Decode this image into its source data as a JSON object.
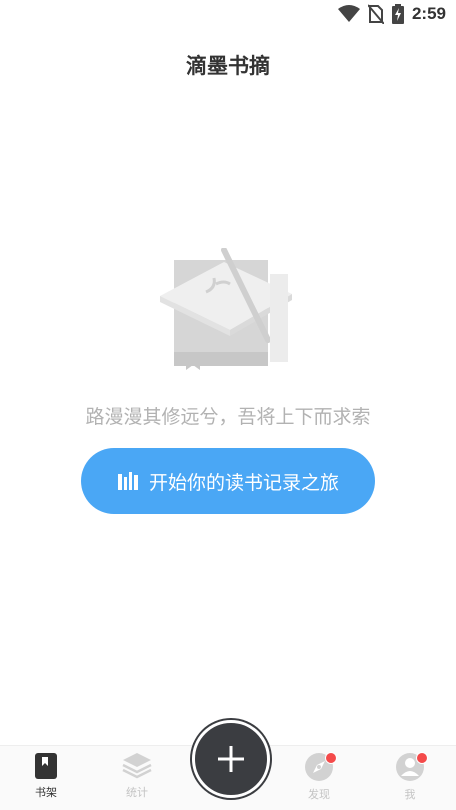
{
  "status_bar": {
    "time": "2:59",
    "icons": [
      "wifi-icon",
      "no-sim-icon",
      "battery-charging-icon"
    ]
  },
  "header": {
    "title": "滴墨书摘"
  },
  "empty_state": {
    "illustration": "empty-book-icon",
    "quote": "路漫漫其修远兮，吾将上下而求索",
    "button_label": "开始你的读书记录之旅",
    "button_icon": "bookshelf-icon"
  },
  "bottom_nav": {
    "items": [
      {
        "label": "书架",
        "icon": "bookshelf-icon",
        "active": true,
        "badge": false
      },
      {
        "label": "统计",
        "icon": "layers-icon",
        "active": false,
        "badge": false
      },
      {
        "label": "发现",
        "icon": "compass-icon",
        "active": false,
        "badge": true
      },
      {
        "label": "我",
        "icon": "profile-icon",
        "active": false,
        "badge": true
      }
    ],
    "fab_icon": "plus-icon"
  },
  "colors": {
    "accent": "#4aa7f5",
    "badge": "#f44a4a",
    "fab": "#3b3d41",
    "text": "#333333",
    "muted": "#b2b2b2"
  }
}
